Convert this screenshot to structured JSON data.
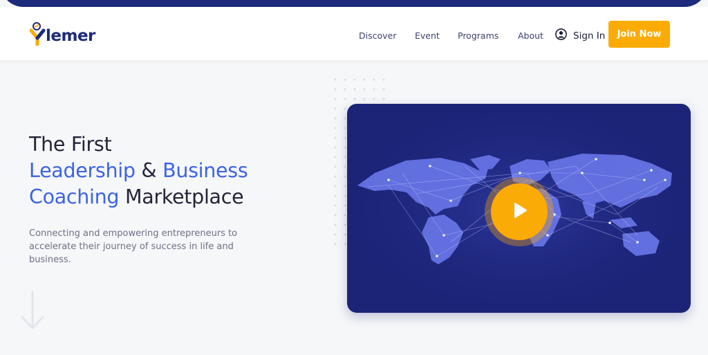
{
  "brand": {
    "name": "lemer",
    "logo_initial": "Y",
    "primary_color": "#1e2a7b",
    "accent_color": "#fbab05",
    "highlight_color": "#3b63e4"
  },
  "nav": {
    "items": [
      {
        "label": "Discover"
      },
      {
        "label": "Event"
      },
      {
        "label": "Programs"
      },
      {
        "label": "About"
      }
    ],
    "sign_in_label": "Sign In",
    "sign_in_icon": "user-circle-icon",
    "join_label": "Join Now"
  },
  "hero": {
    "title_line1": "The First",
    "title_word_leadership": "Leadership",
    "title_amp": "&",
    "title_word_business": "Business",
    "title_word_coaching": "Coaching",
    "title_word_marketplace": "Marketplace",
    "subtitle": "Connecting and empowering entrepreneurs to accelerate their journey of success in life and business.",
    "scroll_icon": "arrow-down-icon"
  },
  "video": {
    "play_icon": "play-icon",
    "background_icon": "world-map-network"
  }
}
